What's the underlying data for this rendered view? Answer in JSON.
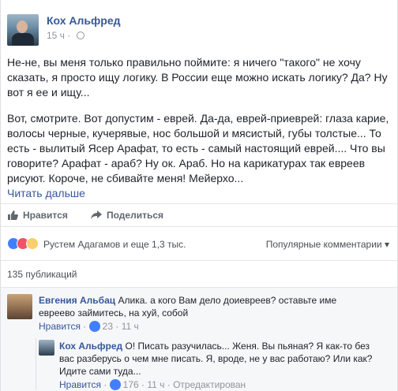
{
  "post": {
    "author": "Кох Альфред",
    "time": "15 ч",
    "paragraph1": "Не-не, вы меня только правильно поймите: я ничего \"такого\" не хочу сказать, я просто ищу логику. В России еще можно искать логику? Да? Ну вот я ее и ищу...",
    "paragraph2": "Вот, смотрите. Вот допустим - еврей. Да-да, еврей-приеврей: глаза карие, волосы черные, кучерявые, нос большой и мясистый, губы толстые... То есть - вылитый Ясер Арафат, то есть - самый настоящий еврей.... Что вы говорите? Арафат - араб? Ну ок. Араб. Но на карикатурах так евреев рисуют. Короче, не сбивайте меня! Мейерхо...",
    "read_more": "Читать дальше"
  },
  "actions": {
    "like_label": "Нравится",
    "share_label": "Поделиться"
  },
  "reactions": {
    "summary": "Рустем Адагамов и еще 1,3 тыс.",
    "sort_label": "Популярные комментарии ▾"
  },
  "publications": "135 публикаций",
  "comments": [
    {
      "author": "Евгения Альбац",
      "text": "Алика. а кого Вам дело доиевреев? оставьте име евреево займитесь, на хуй, собой",
      "like_label": "Нравится",
      "likes": "23",
      "time": "11 ч"
    },
    {
      "author": "Кох Альфред",
      "text": "О! Писать разучилась... Женя. Вы пьяная? Я как-то без вас разберусь о чем мне писать. Я, вроде, не у вас работаю? Или как? Идите сами туда...",
      "like_label": "Нравится",
      "likes": "176",
      "time": "11 ч",
      "edited": "Отредактирован"
    }
  ],
  "colors": {
    "link": "#365899",
    "meta": "#90949c",
    "like": "#4080ff"
  }
}
